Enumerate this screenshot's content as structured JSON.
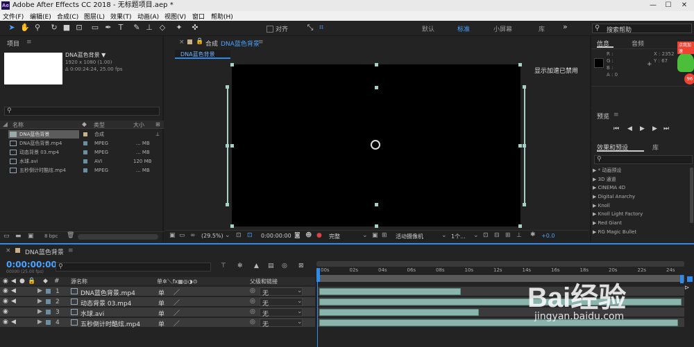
{
  "window": {
    "title": "Adobe After Effects CC 2018 - 无标题项目.aep *",
    "app_icon": "Ae",
    "minimize": "—",
    "maximize": "☐",
    "close": "✕"
  },
  "menu": [
    "文件(F)",
    "编辑(E)",
    "合成(C)",
    "图层(L)",
    "效果(T)",
    "动画(A)",
    "视图(V)",
    "窗口",
    "帮助(H)"
  ],
  "toolbar": {
    "snap_label": "对齐",
    "workspaces": [
      "默认",
      "标准",
      "小屏幕",
      "库"
    ],
    "more": "»",
    "search_placeholder": "搜索帮助"
  },
  "project": {
    "title": "项目",
    "comp_name": "DNA蓝色背景 ▼",
    "comp_size": "1920 x 1080 (1.00)",
    "comp_duration": "Δ 0:00:24:24, 25.00 fps",
    "columns": [
      "名称",
      "类型",
      "大小"
    ],
    "items": [
      {
        "name": "DNA蓝色背景",
        "type": "合成",
        "size": ""
      },
      {
        "name": "DNA蓝色背景.mp4",
        "type": "MPEG",
        "size": "... MB"
      },
      {
        "name": "动态背景 03.mp4",
        "type": "MPEG",
        "size": "... MB"
      },
      {
        "name": "水球.avi",
        "type": "AVI",
        "size": "120 MB"
      },
      {
        "name": "五秒倒计时酷炫.mp4",
        "type": "MPEG",
        "size": "... MB"
      }
    ],
    "bpc": "8 bpc"
  },
  "composition": {
    "panel_prefix": "合成",
    "name": "DNA蓝色背景",
    "tab": "DNA蓝色背景",
    "gpu_note": "显示加速已禁用",
    "zoom": "(29.5%)",
    "timecode": "0:00:00:00",
    "quality": "完整",
    "camera": "活动摄像机",
    "views": "1个...",
    "exposure": "+0.0"
  },
  "info": {
    "tabs": [
      "信息",
      "音频"
    ],
    "r": "R :",
    "g": "G :",
    "b": "B :",
    "a": "A : 0",
    "x": "X : 2352",
    "y": "Y : 67",
    "badge_text": "点我加速",
    "badge_pct": "96"
  },
  "preview": {
    "title": "预览"
  },
  "effects": {
    "tabs": [
      "效果和预设",
      "库"
    ],
    "items": [
      "* 动画预设",
      "3D 通道",
      "CINEMA 4D",
      "Digital Anarchy",
      "Knoll",
      "Knoll Light Factory",
      "Red Giant",
      "RG Magic Bullet"
    ]
  },
  "timeline": {
    "tab": "DNA蓝色背景",
    "timecode": "0:00:00:00",
    "timecode_sub": "00000 (25.00 fps)",
    "col_source": "源名称",
    "col_parent": "父级和链接",
    "ruler": [
      "00s",
      "02s",
      "04s",
      "06s",
      "08s",
      "10s",
      "12s",
      "14s",
      "16s",
      "18s",
      "20s",
      "22s",
      "24s"
    ],
    "layers": [
      {
        "num": "1",
        "name": "DNA蓝色背景.mp4",
        "parent": "无",
        "bar_end": 0.39
      },
      {
        "num": "2",
        "name": "动态背景 03.mp4",
        "parent": "无",
        "bar_end": 1.0
      },
      {
        "num": "3",
        "name": "水球.avi",
        "parent": "无",
        "bar_end": 0.44
      },
      {
        "num": "4",
        "name": "五秒倒计时酷炫.mp4",
        "parent": "无",
        "bar_end": 0.99
      }
    ]
  },
  "watermark": {
    "brand": "Bai经验",
    "url": "jingyan.baidu.com"
  },
  "colors": {
    "accent": "#2d8ceb",
    "bar": "#8ab5ad",
    "handle": "#a6d1c7"
  }
}
